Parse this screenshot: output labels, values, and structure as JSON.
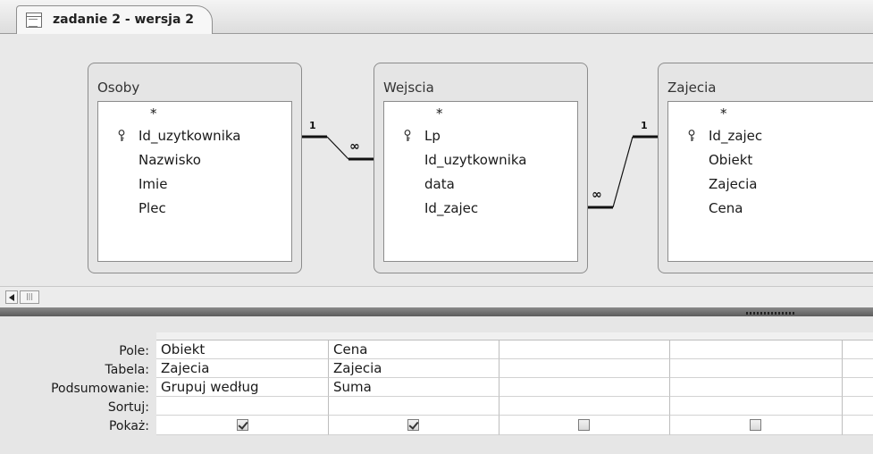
{
  "document_tab": {
    "title": "zadanie 2 - wersja 2"
  },
  "tables": [
    {
      "name": "Osoby",
      "fields": [
        "*",
        "Id_uzytkownika",
        "Nazwisko",
        "Imie",
        "Plec"
      ],
      "key_field": "Id_uzytkownika"
    },
    {
      "name": "Wejscia",
      "fields": [
        "*",
        "Lp",
        "Id_uzytkownika",
        "data",
        "Id_zajec"
      ],
      "key_field": "Lp"
    },
    {
      "name": "Zajecia",
      "fields": [
        "*",
        "Id_zajec",
        "Obiekt",
        "Zajecia",
        "Cena"
      ],
      "key_field": "Id_zajec"
    }
  ],
  "relationships": [
    {
      "from": "Osoby.Id_uzytkownika",
      "to": "Wejscia.Id_uzytkownika",
      "one_label": "1",
      "many_label": "∞"
    },
    {
      "from": "Zajecia.Id_zajec",
      "to": "Wejscia.Id_zajec",
      "one_label": "1",
      "many_label": "∞"
    }
  ],
  "query_grid": {
    "row_labels": [
      "Pole:",
      "Tabela:",
      "Podsumowanie:",
      "Sortuj:",
      "Pokaż:"
    ],
    "columns": [
      {
        "pole": "Obiekt",
        "tabela": "Zajecia",
        "podsumowanie": "Grupuj według",
        "sortuj": "",
        "pokaz": true
      },
      {
        "pole": "Cena",
        "tabela": "Zajecia",
        "podsumowanie": "Suma",
        "sortuj": "",
        "pokaz": true
      },
      {
        "pole": "",
        "tabela": "",
        "podsumowanie": "",
        "sortuj": "",
        "pokaz": false
      },
      {
        "pole": "",
        "tabela": "",
        "podsumowanie": "",
        "sortuj": "",
        "pokaz": false
      },
      {
        "pole": "",
        "tabela": "",
        "podsumowanie": "",
        "sortuj": "",
        "pokaz": false
      }
    ]
  },
  "scrollbar": {
    "thumb_glyph": "|||"
  }
}
